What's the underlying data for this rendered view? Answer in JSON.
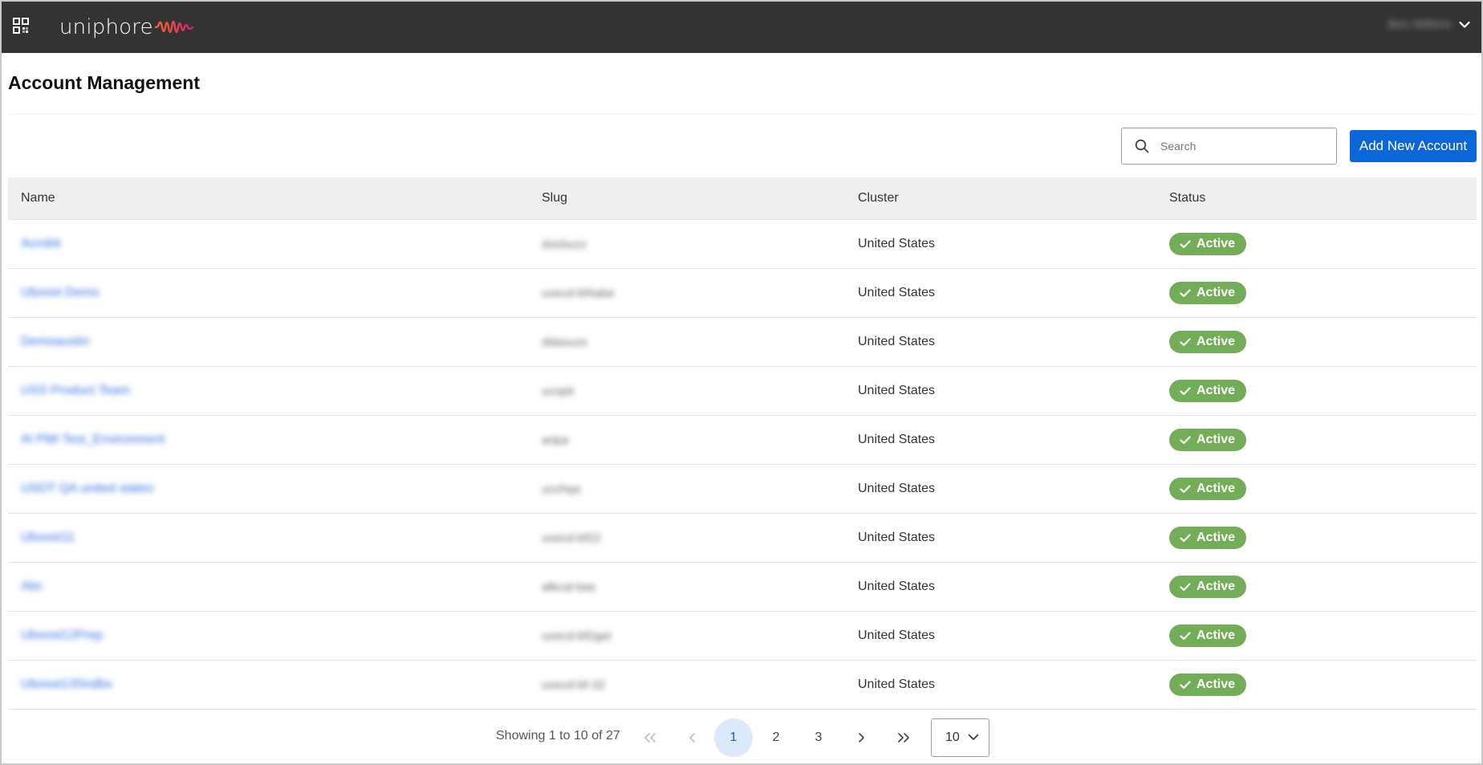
{
  "header": {
    "apps_icon": "grid-apps-icon",
    "logo_text": "uniphore",
    "user_name": "Ben Wilkins",
    "user_chevron_icon": "chevron-down-icon",
    "colors": {
      "bar": "#333333",
      "wave_start": "#f26a2e",
      "wave_end": "#d6206b"
    }
  },
  "page": {
    "title": "Account Management"
  },
  "toolbar": {
    "search_placeholder": "Search",
    "search_value": "",
    "search_icon": "search-icon",
    "add_button_label": "Add New Account",
    "add_button_color": "#0b66d8"
  },
  "table": {
    "columns": [
      "Name",
      "Slug",
      "Cluster",
      "Status"
    ],
    "rows": [
      {
        "name": "Acrobit",
        "slug": "docbuzz",
        "cluster": "United States",
        "status": "Active"
      },
      {
        "name": "Uboost Demo",
        "slug": "uxecd-bf4abe",
        "cluster": "United States",
        "status": "Active"
      },
      {
        "name": "Demoaustin",
        "slug": "ddaouzs",
        "cluster": "United States",
        "status": "Active"
      },
      {
        "name": "USS Product Team",
        "slug": "ucopit",
        "cluster": "United States",
        "status": "Active"
      },
      {
        "name": "Al PMI Test_Environment",
        "slug": "aripa",
        "cluster": "United States",
        "status": "Active"
      },
      {
        "name": "USDT QA united states",
        "slug": "ucchqa",
        "cluster": "United States",
        "status": "Active"
      },
      {
        "name": "Uboost11",
        "slug": "uxecd-bf22",
        "cluster": "United States",
        "status": "Active"
      },
      {
        "name": "Abc",
        "slug": "alkcal-bas",
        "cluster": "United States",
        "status": "Active"
      },
      {
        "name": "Uboost12Prep",
        "slug": "uxecd-bf2get",
        "cluster": "United States",
        "status": "Active"
      },
      {
        "name": "Uboost13Sndbx",
        "slug": "uxecd-bf-32",
        "cluster": "United States",
        "status": "Active"
      }
    ],
    "status_color": "#74ad57",
    "status_icon": "check-icon"
  },
  "pagination": {
    "showing_text": "Showing 1 to 10 of 27",
    "first_icon": "chevrons-left-icon",
    "prev_icon": "chevron-left-icon",
    "next_icon": "chevron-right-icon",
    "last_icon": "chevrons-right-icon",
    "pages": [
      "1",
      "2",
      "3"
    ],
    "current_page": "1",
    "page_size": "10"
  }
}
